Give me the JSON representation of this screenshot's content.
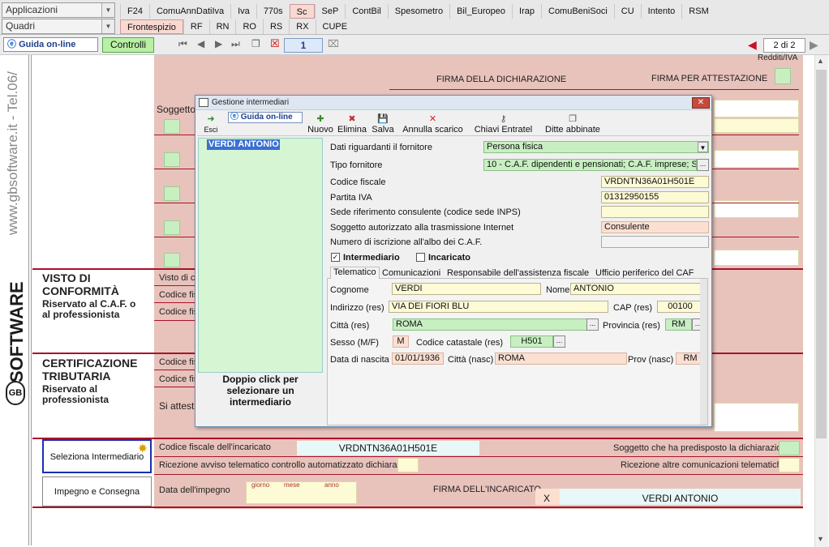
{
  "menus": {
    "applicazioni": "Applicazioni",
    "quadri": "Quadri"
  },
  "tabs_row1": [
    "F24",
    "ComuAnnDatiIva",
    "Iva",
    "770s",
    "Sc",
    "SeP",
    "ContBil",
    "Spesometro",
    "Bil_Europeo",
    "Irap",
    "ComuBeniSoci",
    "CU",
    "Intento",
    "RSM"
  ],
  "tabs_row2": [
    "Frontespizio",
    "RF",
    "RN",
    "RO",
    "RS",
    "RX",
    "CUPE"
  ],
  "toolbar": {
    "guida": "Guida on-line",
    "controlli": "Controlli",
    "page_input": "1",
    "page_count": "2 di 2"
  },
  "side_brand": {
    "url": "www.gbsoftware.it - Tel.06/",
    "brand": "SOFTWARE",
    "logo": "GB"
  },
  "form": {
    "redditi_iva": "Redditi/IVA",
    "firma_dich": "FIRMA DELLA DICHIARAZIONE",
    "firma_attest": "FIRMA PER ATTESTAZIONE",
    "soggetto": "Soggetto",
    "visto_title": "VISTO DI CONFORMITÀ",
    "visto_sub": "Riservato al C.A.F. o al professionista",
    "visto_row1": "Visto di c",
    "codice_fisc": "Codice fisc",
    "codice_fis": "Codice fis",
    "cert_title": "CERTIFICAZIONE TRIBUTARIA",
    "cert_sub": "Riservato al professionista",
    "si_attest": "Si attest",
    "seleziona": "Seleziona Intermediario",
    "impegno": "Impegno e Consegna",
    "cf_incaricato_lbl": "Codice fiscale dell'incaricato",
    "cf_incaricato_val": "VRDNTN36A01H501E",
    "soggetto_predisposto": "Soggetto che ha predisposto la dichiarazione",
    "ricezione_avviso": "Ricezione avviso telematico controllo automatizzato dichiarazione",
    "ricezione_altre": "Ricezione altre comunicazioni telematiche",
    "data_impegno": "Data dell'impegno",
    "giorno": "giorno",
    "mese": "mese",
    "anno": "anno",
    "firma_incaricato": "FIRMA DELL'INCARICATO",
    "x_mark": "X",
    "nome_incaricato": "VERDI ANTONIO"
  },
  "dialog": {
    "title": "Gestione intermediari",
    "btn_esci": "Esci",
    "btn_guida": "Guida on-line",
    "btn_nuovo": "Nuovo",
    "btn_elimina": "Elimina",
    "btn_salva": "Salva",
    "btn_annulla": "Annulla scarico",
    "btn_chiavi": "Chiavi Entratel",
    "btn_ditte": "Ditte abbinate",
    "list_item": "VERDI ANTONIO",
    "list_hint": "Doppio click per selezionare un intermediario",
    "fields": {
      "dati_fornitore_lbl": "Dati riguardanti il fornitore",
      "dati_fornitore": "Persona fisica",
      "tipo_fornitore_lbl": "Tipo fornitore",
      "tipo_fornitore": "10 - C.A.F. dipendenti e pensionati; C.A.F. imprese; S",
      "cf_lbl": "Codice fiscale",
      "cf": "VRDNTN36A01H501E",
      "piva_lbl": "Partita IVA",
      "piva": "01312950155",
      "sede_lbl": "Sede riferimento consulente (codice sede INPS)",
      "sede": "",
      "soggetto_lbl": "Soggetto autorizzato alla trasmissione Internet",
      "soggetto": "Consulente",
      "albo_lbl": "Numero di iscrizione all'albo dei C.A.F.",
      "albo": ""
    },
    "chk_intermediario": "Intermediario",
    "chk_incaricato": "Incaricato",
    "subtabs": [
      "Telematico",
      "Comunicazioni",
      "Responsabile dell'assistenza fiscale",
      "Ufficio periferico del CAF"
    ],
    "tel": {
      "cognome_lbl": "Cognome",
      "cognome": "VERDI",
      "nome_lbl": "Nome",
      "nome": "ANTONIO",
      "indirizzo_lbl": "Indirizzo (res)",
      "indirizzo": "VIA DEI FIORI BLU",
      "cap_lbl": "CAP (res)",
      "cap": "00100",
      "citta_lbl": "Città (res)",
      "citta": "ROMA",
      "prov_lbl": "Provincia (res)",
      "prov": "RM",
      "sesso_lbl": "Sesso (M/F)",
      "sesso": "M",
      "catastale_lbl": "Codice catastale (res)",
      "catastale": "H501",
      "nascita_lbl": "Data di nascita",
      "nascita": "01/01/1936",
      "citta_nasc_lbl": "Città (nasc)",
      "citta_nasc": "ROMA",
      "prov_nasc_lbl": "Prov (nasc)",
      "prov_nasc": "RM"
    }
  }
}
